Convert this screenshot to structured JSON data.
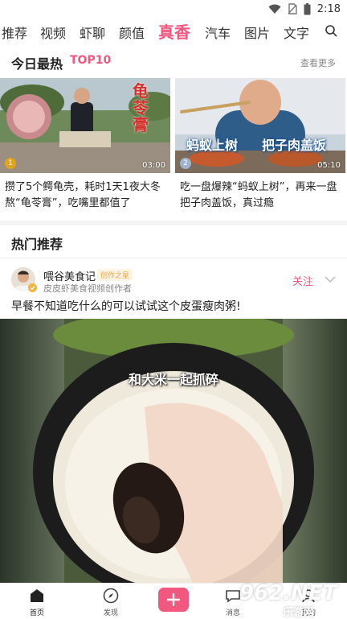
{
  "status_bar": {
    "time": "2:18",
    "icons": [
      "wifi-icon",
      "no-sim-icon",
      "battery-icon"
    ]
  },
  "tabs": [
    {
      "label": "推荐",
      "active": false
    },
    {
      "label": "视频",
      "active": false
    },
    {
      "label": "虾聊",
      "active": false
    },
    {
      "label": "颜值",
      "active": false
    },
    {
      "label": "真香",
      "active": true
    },
    {
      "label": "汽车",
      "active": false
    },
    {
      "label": "图片",
      "active": false
    },
    {
      "label": "文字",
      "active": false
    }
  ],
  "top10": {
    "title": "今日最热",
    "badge": "TOP10",
    "more": "查看更多",
    "cards": [
      {
        "rank": "1",
        "duration": "03:00",
        "thumb_text": "龟苓膏",
        "title": "攒了5个鳄龟壳，耗时1天1夜大冬熬“龟苓膏”，吃嘴里都值了"
      },
      {
        "rank": "2",
        "duration": "05:10",
        "thumb_text_1": "蚂蚁上树",
        "thumb_text_2": "把子肉盖饭",
        "title": "吃一盘爆辣“蚂蚁上树”，再来一盘把子肉盖饭，真过瘾"
      }
    ]
  },
  "hot": {
    "title": "热门推荐",
    "post": {
      "author": "喂谷美食记",
      "tag": "创作之星",
      "desc": "皮皮虾美食视频创作者",
      "follow": "关注",
      "text": "早餐不知道吃什么的可以试试这个皮蛋瘦肉粥!",
      "video_caption": "和大米一起抓碎"
    }
  },
  "bottom_nav": [
    {
      "label": "首页",
      "icon": "home-icon",
      "active": true
    },
    {
      "label": "发现",
      "icon": "compass-icon",
      "active": false
    },
    {
      "label": "",
      "icon": "add-icon",
      "active": false
    },
    {
      "label": "消息",
      "icon": "message-icon",
      "active": false
    },
    {
      "label": "我的",
      "icon": "profile-icon",
      "active": false
    }
  ],
  "watermark": {
    "main": "962.NET",
    "sub": "乐游网"
  },
  "colors": {
    "accent": "#f0587f",
    "tag": "#f0a23a"
  }
}
